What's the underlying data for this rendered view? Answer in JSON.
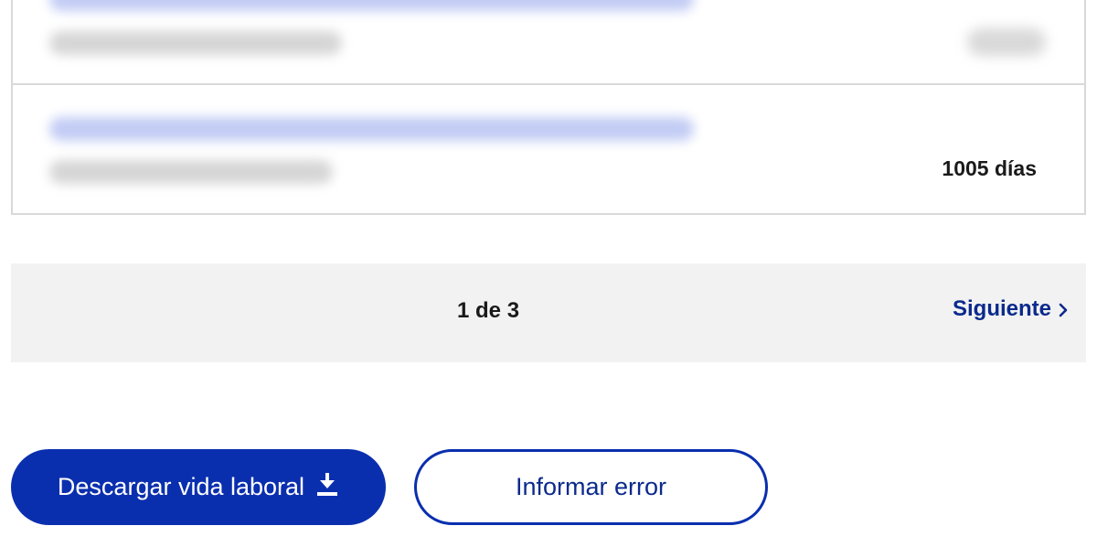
{
  "employment_list": {
    "rows": [
      {
        "company": "",
        "dates": "",
        "days": ""
      },
      {
        "company": "",
        "dates": "",
        "days": "1005 días"
      }
    ]
  },
  "pagination": {
    "indicator": "1 de 3",
    "next_label": "Siguiente"
  },
  "actions": {
    "download_label": "Descargar vida laboral",
    "report_label": "Informar error"
  },
  "icons": {
    "download": "download-icon",
    "next": "chevron-right-icon"
  },
  "colors": {
    "primary": "#0a2fae",
    "link": "#0b2a8c",
    "bar_bg": "#f2f2f2",
    "border": "#d9d9d9"
  }
}
